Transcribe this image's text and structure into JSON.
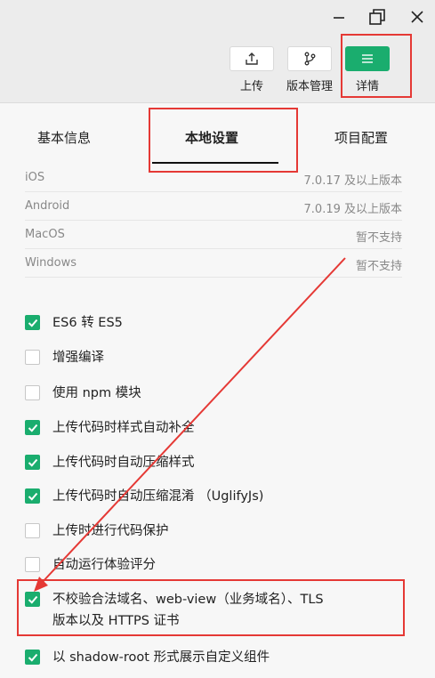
{
  "toolbar": {
    "upload_label": "上传",
    "version_label": "版本管理",
    "details_label": "详情",
    "accent": "#1aad6e"
  },
  "tabs": [
    {
      "label": "基本信息"
    },
    {
      "label": "本地设置",
      "active": true
    },
    {
      "label": "项目配置"
    }
  ],
  "versions": [
    {
      "platform": "iOS",
      "support": "7.0.17 及以上版本"
    },
    {
      "platform": "Android",
      "support": "7.0.19 及以上版本"
    },
    {
      "platform": "MacOS",
      "support": "暂不支持"
    },
    {
      "platform": "Windows",
      "support": "暂不支持"
    }
  ],
  "options": [
    {
      "label": "ES6 转 ES5",
      "checked": true
    },
    {
      "label": "增强编译",
      "checked": false
    },
    {
      "label": "使用 npm 模块",
      "checked": false
    },
    {
      "label": "上传代码时样式自动补全",
      "checked": true
    },
    {
      "label": "上传代码时自动压缩样式",
      "checked": true
    },
    {
      "label": "上传代码时自动压缩混淆 （UglifyJs)",
      "checked": true
    },
    {
      "label": "上传时进行代码保护",
      "checked": false
    },
    {
      "label": "自动运行体验评分",
      "checked": false
    },
    {
      "label": "不校验合法域名、web-view（业务域名）、TLS",
      "label2": "版本以及 HTTPS 证书",
      "checked": true
    },
    {
      "label": "以 shadow-root 形式展示自定义组件",
      "checked": true
    }
  ]
}
